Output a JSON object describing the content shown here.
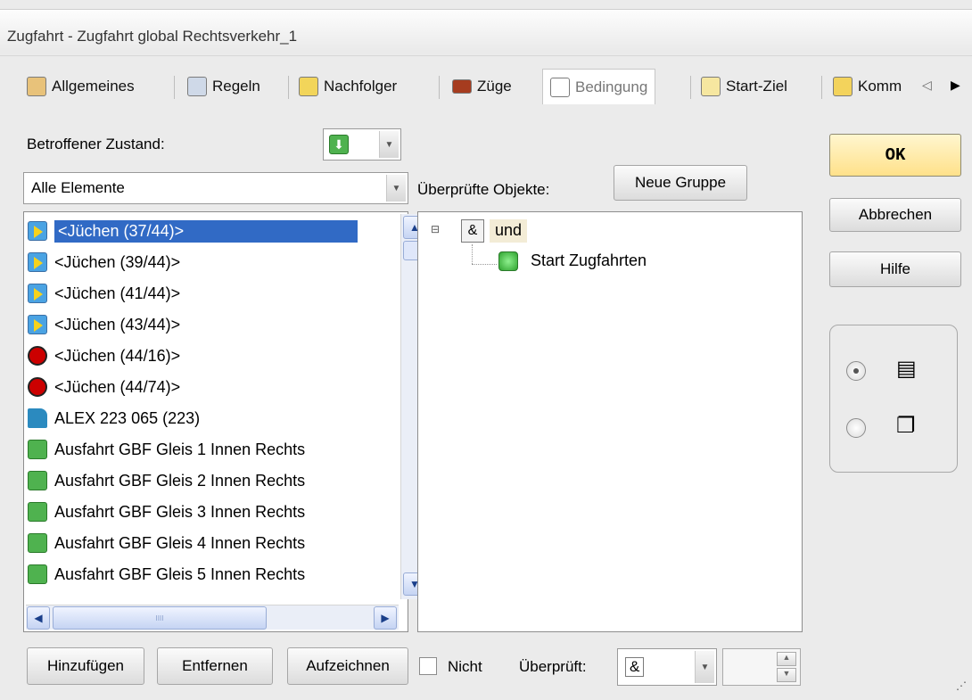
{
  "window": {
    "title": "Zugfahrt - Zugfahrt global Rechtsverkehr_1"
  },
  "tabs": [
    {
      "label": "Allgemeines",
      "icon": "general-icon"
    },
    {
      "label": "Regeln",
      "icon": "rules-icon"
    },
    {
      "label": "Nachfolger",
      "icon": "successor-icon"
    },
    {
      "label": "Züge",
      "icon": "trains-icon"
    },
    {
      "label": "Bedingung",
      "icon": "condition-icon",
      "active": true
    },
    {
      "label": "Start-Ziel",
      "icon": "start-destination-icon"
    },
    {
      "label": "Komm",
      "icon": "comment-icon"
    }
  ],
  "state": {
    "label": "Betroffener Zustand:",
    "selected_icon": "green-down-arrow-icon"
  },
  "filter": {
    "value": "Alle Elemente"
  },
  "elements": [
    {
      "label": "<Jüchen (37/44)>",
      "icon": "signal-icon",
      "selected": true
    },
    {
      "label": "<Jüchen (39/44)>",
      "icon": "signal-icon"
    },
    {
      "label": "<Jüchen (41/44)>",
      "icon": "signal-icon"
    },
    {
      "label": "<Jüchen (43/44)>",
      "icon": "signal-icon"
    },
    {
      "label": "<Jüchen (44/16)>",
      "icon": "red-signal-icon"
    },
    {
      "label": "<Jüchen (44/74)>",
      "icon": "red-signal-icon"
    },
    {
      "label": "ALEX 223 065 (223)",
      "icon": "train-icon"
    },
    {
      "label": "Ausfahrt GBF Gleis 1 Innen Rechts",
      "icon": "route-icon"
    },
    {
      "label": "Ausfahrt GBF Gleis 2 Innen Rechts",
      "icon": "route-icon"
    },
    {
      "label": "Ausfahrt GBF Gleis 3 Innen Rechts",
      "icon": "route-icon"
    },
    {
      "label": "Ausfahrt GBF Gleis 4 Innen Rechts",
      "icon": "route-icon"
    },
    {
      "label": "Ausfahrt GBF Gleis 5 Innen Rechts",
      "icon": "route-icon"
    }
  ],
  "checked": {
    "label": "Überprüfte Objekte:",
    "new_group_button": "Neue Gruppe",
    "tree": {
      "root_symbol": "&",
      "root_label": "und",
      "child_label": "Start Zugfahrten"
    }
  },
  "buttons": {
    "ok": "OK",
    "cancel": "Abbrechen",
    "help": "Hilfe",
    "add": "Hinzufügen",
    "remove": "Entfernen",
    "record": "Aufzeichnen"
  },
  "bottom": {
    "not_label": "Nicht",
    "checked_label": "Überprüft:",
    "checked_value": "&"
  },
  "colors": {
    "selection": "#316ac5",
    "ok_button": "#fff0b8",
    "tree_highlight": "#f3ecd6"
  }
}
